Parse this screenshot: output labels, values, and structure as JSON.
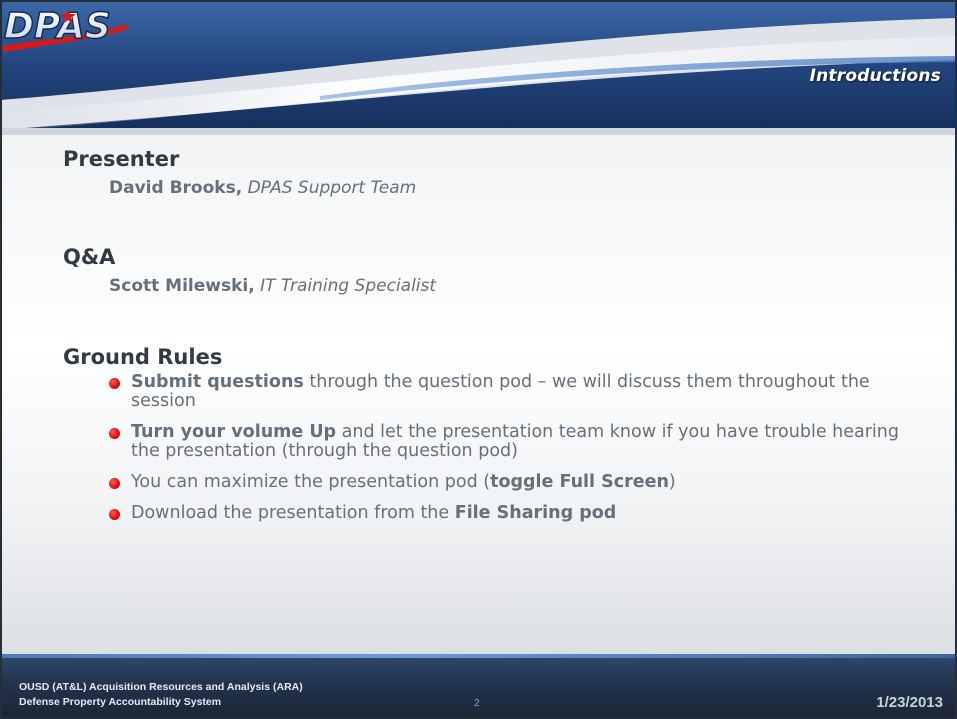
{
  "header": {
    "logo_text": "DPAS",
    "section_title": "Introductions"
  },
  "presenter": {
    "heading": "Presenter",
    "name": "David Brooks,",
    "role": "DPAS Support Team"
  },
  "qa": {
    "heading": "Q&A",
    "name": "Scott Milewski,",
    "role": "IT Training Specialist"
  },
  "ground_rules": {
    "heading": "Ground Rules",
    "items": [
      {
        "bold_lead": "Submit questions",
        "text": " through the question pod – we will discuss them throughout the session"
      },
      {
        "bold_lead": "Turn your volume Up",
        "text": " and let the presentation team know if you have trouble hearing the presentation (through the question pod)"
      },
      {
        "pre": "You can maximize the presentation pod (",
        "bold": "toggle Full Screen",
        "post": ")"
      },
      {
        "pre": "Download the presentation from the ",
        "bold": "File Sharing pod",
        "post": ""
      }
    ]
  },
  "footer": {
    "org_line1": "OUSD (AT&L) Acquisition Resources and Analysis (ARA)",
    "org_line2": "Defense Property Accountability System",
    "page_number": "2",
    "date": "1/23/2013"
  },
  "colors": {
    "header_blue": "#1f3f7a",
    "bullet_red": "#e01010",
    "heading_text": "#333a44",
    "body_text": "#66707b"
  }
}
